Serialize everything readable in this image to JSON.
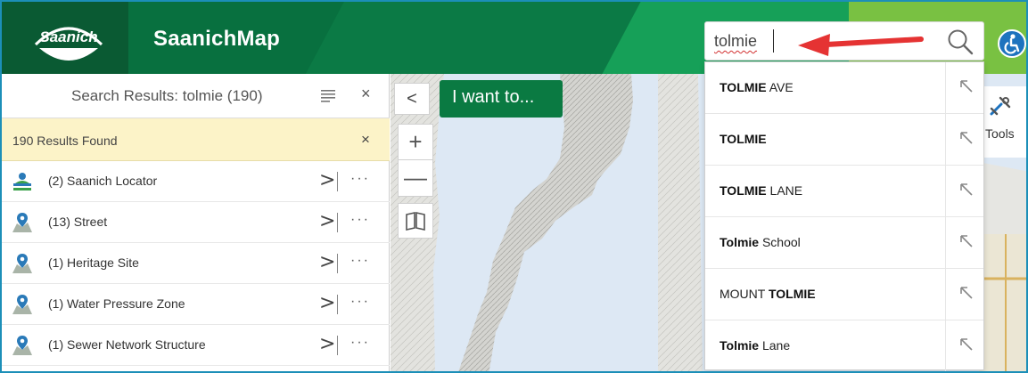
{
  "header": {
    "logo_text": "Saanich",
    "title": "SaanichMap",
    "search": {
      "value": "tolmie"
    },
    "colors": {
      "dark_green": "#08703f",
      "light_green": "#79c142",
      "accessibility_blue": "#1e73be"
    }
  },
  "panel": {
    "title": "Search Results: tolmie (190)",
    "close_label": "×",
    "results_found": "190 Results Found",
    "results_close": "×",
    "rows": [
      {
        "label": "(2) Saanich Locator",
        "icon": "saanich-locator-icon"
      },
      {
        "label": "(13) Street",
        "icon": "map-pin-icon"
      },
      {
        "label": "(1) Heritage Site",
        "icon": "map-pin-icon"
      },
      {
        "label": "(1) Water Pressure Zone",
        "icon": "map-pin-icon"
      },
      {
        "label": "(1) Sewer Network Structure",
        "icon": "map-pin-icon"
      }
    ],
    "row_chevron": ">",
    "row_more": "···"
  },
  "map": {
    "collapse_label": "<",
    "i_want_to": "I want to...",
    "zoom_in": "+",
    "zoom_out": "—",
    "tools_label": "Tools"
  },
  "suggestions": [
    {
      "bold": "TOLMIE",
      "rest": " AVE"
    },
    {
      "bold": "TOLMIE",
      "rest": ""
    },
    {
      "bold": "TOLMIE",
      "rest": " LANE"
    },
    {
      "bold": "Tolmie",
      "rest": " School"
    },
    {
      "pre": "MOUNT ",
      "bold": "TOLMIE",
      "rest": ""
    },
    {
      "bold": "Tolmie",
      "rest": " Lane"
    }
  ]
}
